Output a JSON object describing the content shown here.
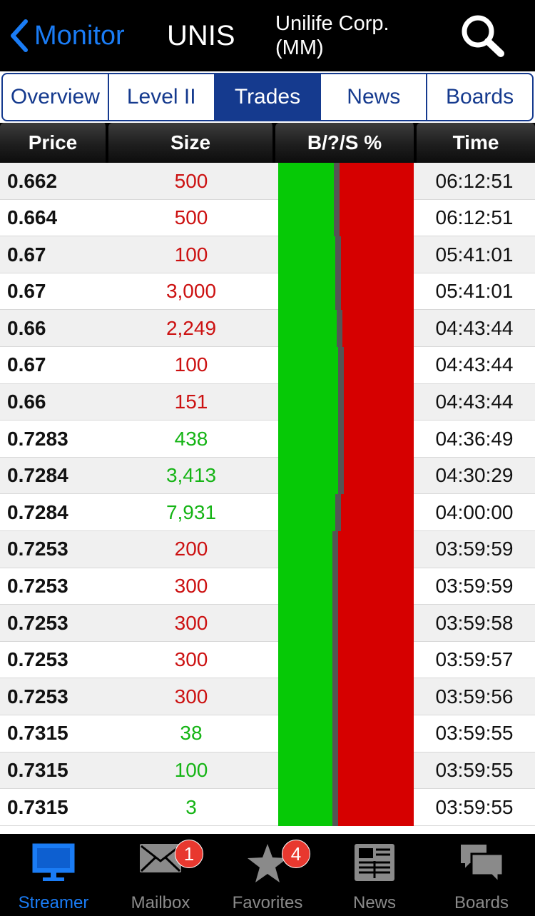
{
  "header": {
    "back_label": "Monitor",
    "symbol": "UNIS",
    "company_line1": "Unilife Corp.",
    "company_line2": "(MM)"
  },
  "tabs": [
    {
      "label": "Overview",
      "active": false
    },
    {
      "label": "Level II",
      "active": false
    },
    {
      "label": "Trades",
      "active": true
    },
    {
      "label": "News",
      "active": false
    },
    {
      "label": "Boards",
      "active": false
    }
  ],
  "columns": {
    "price": "Price",
    "size": "Size",
    "bss": "B/?/S %",
    "time": "Time"
  },
  "trades": [
    {
      "price": "0.662",
      "size": "500",
      "side": "sell",
      "time": "06:12:51"
    },
    {
      "price": "0.664",
      "size": "500",
      "side": "sell",
      "time": "06:12:51"
    },
    {
      "price": "0.67",
      "size": "100",
      "side": "sell",
      "time": "05:41:01"
    },
    {
      "price": "0.67",
      "size": "3,000",
      "side": "sell",
      "time": "05:41:01"
    },
    {
      "price": "0.66",
      "size": "2,249",
      "side": "sell",
      "time": "04:43:44"
    },
    {
      "price": "0.67",
      "size": "100",
      "side": "sell",
      "time": "04:43:44"
    },
    {
      "price": "0.66",
      "size": "151",
      "side": "sell",
      "time": "04:43:44"
    },
    {
      "price": "0.7283",
      "size": "438",
      "side": "buy",
      "time": "04:36:49"
    },
    {
      "price": "0.7284",
      "size": "3,413",
      "side": "buy",
      "time": "04:30:29"
    },
    {
      "price": "0.7284",
      "size": "7,931",
      "side": "buy",
      "time": "04:00:00"
    },
    {
      "price": "0.7253",
      "size": "200",
      "side": "sell",
      "time": "03:59:59"
    },
    {
      "price": "0.7253",
      "size": "300",
      "side": "sell",
      "time": "03:59:59"
    },
    {
      "price": "0.7253",
      "size": "300",
      "side": "sell",
      "time": "03:59:58"
    },
    {
      "price": "0.7253",
      "size": "300",
      "side": "sell",
      "time": "03:59:57"
    },
    {
      "price": "0.7253",
      "size": "300",
      "side": "sell",
      "time": "03:59:56"
    },
    {
      "price": "0.7315",
      "size": "38",
      "side": "buy",
      "time": "03:59:55"
    },
    {
      "price": "0.7315",
      "size": "100",
      "side": "buy",
      "time": "03:59:55"
    },
    {
      "price": "0.7315",
      "size": "3",
      "side": "buy",
      "time": "03:59:55"
    }
  ],
  "bss_pct": [
    {
      "buy": 41,
      "unknown": 4,
      "sell": 55
    },
    {
      "buy": 41,
      "unknown": 4,
      "sell": 55
    },
    {
      "buy": 42,
      "unknown": 4,
      "sell": 54
    },
    {
      "buy": 42,
      "unknown": 4,
      "sell": 54
    },
    {
      "buy": 43,
      "unknown": 4,
      "sell": 53
    },
    {
      "buy": 44,
      "unknown": 4,
      "sell": 52
    },
    {
      "buy": 44,
      "unknown": 4,
      "sell": 52
    },
    {
      "buy": 44,
      "unknown": 4,
      "sell": 52
    },
    {
      "buy": 44,
      "unknown": 4,
      "sell": 52
    },
    {
      "buy": 42,
      "unknown": 4,
      "sell": 54
    },
    {
      "buy": 40,
      "unknown": 4,
      "sell": 56
    },
    {
      "buy": 40,
      "unknown": 4,
      "sell": 56
    },
    {
      "buy": 40,
      "unknown": 4,
      "sell": 56
    },
    {
      "buy": 40,
      "unknown": 4,
      "sell": 56
    },
    {
      "buy": 40,
      "unknown": 4,
      "sell": 56
    },
    {
      "buy": 40,
      "unknown": 4,
      "sell": 56
    },
    {
      "buy": 40,
      "unknown": 4,
      "sell": 56
    },
    {
      "buy": 40,
      "unknown": 4,
      "sell": 56
    }
  ],
  "colors": {
    "buy": "#06c906",
    "sell": "#d60000",
    "unknown": "#555555",
    "accent": "#1a7cf5",
    "tab_blue": "#153a8e",
    "badge": "#e8382f"
  },
  "bottom_tabs": [
    {
      "label": "Streamer",
      "icon": "monitor-icon",
      "active": true,
      "badge": null
    },
    {
      "label": "Mailbox",
      "icon": "envelope-icon",
      "active": false,
      "badge": "1"
    },
    {
      "label": "Favorites",
      "icon": "star-icon",
      "active": false,
      "badge": "4"
    },
    {
      "label": "News",
      "icon": "newspaper-icon",
      "active": false,
      "badge": null
    },
    {
      "label": "Boards",
      "icon": "chat-bubbles-icon",
      "active": false,
      "badge": null
    }
  ]
}
